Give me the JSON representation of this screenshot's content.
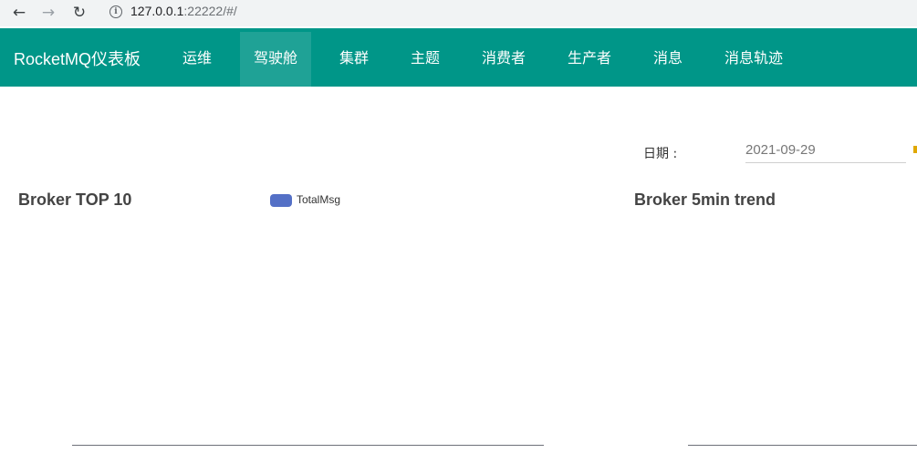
{
  "browser": {
    "url_host": "127.0.0.1",
    "url_rest": ":22222/#/"
  },
  "header": {
    "brand": "RocketMQ仪表板",
    "menu": [
      {
        "label": "运维"
      },
      {
        "label": "驾驶舱",
        "active": true
      },
      {
        "label": "集群"
      },
      {
        "label": "主题"
      },
      {
        "label": "消费者"
      },
      {
        "label": "生产者"
      },
      {
        "label": "消息"
      },
      {
        "label": "消息轨迹"
      }
    ]
  },
  "filter": {
    "date_label": "日期 :",
    "date_value": "2021-09-29"
  },
  "charts": {
    "broker_top10": {
      "title": "Broker TOP 10",
      "legend": "TotalMsg",
      "legend_color": "#5470c6"
    },
    "broker_trend": {
      "title": "Broker 5min trend"
    }
  },
  "chart_data": [
    {
      "type": "bar",
      "title": "Broker TOP 10",
      "series": [
        {
          "name": "TotalMsg",
          "values": []
        }
      ],
      "categories": []
    },
    {
      "type": "line",
      "title": "Broker 5min trend",
      "series": [],
      "x": []
    }
  ]
}
